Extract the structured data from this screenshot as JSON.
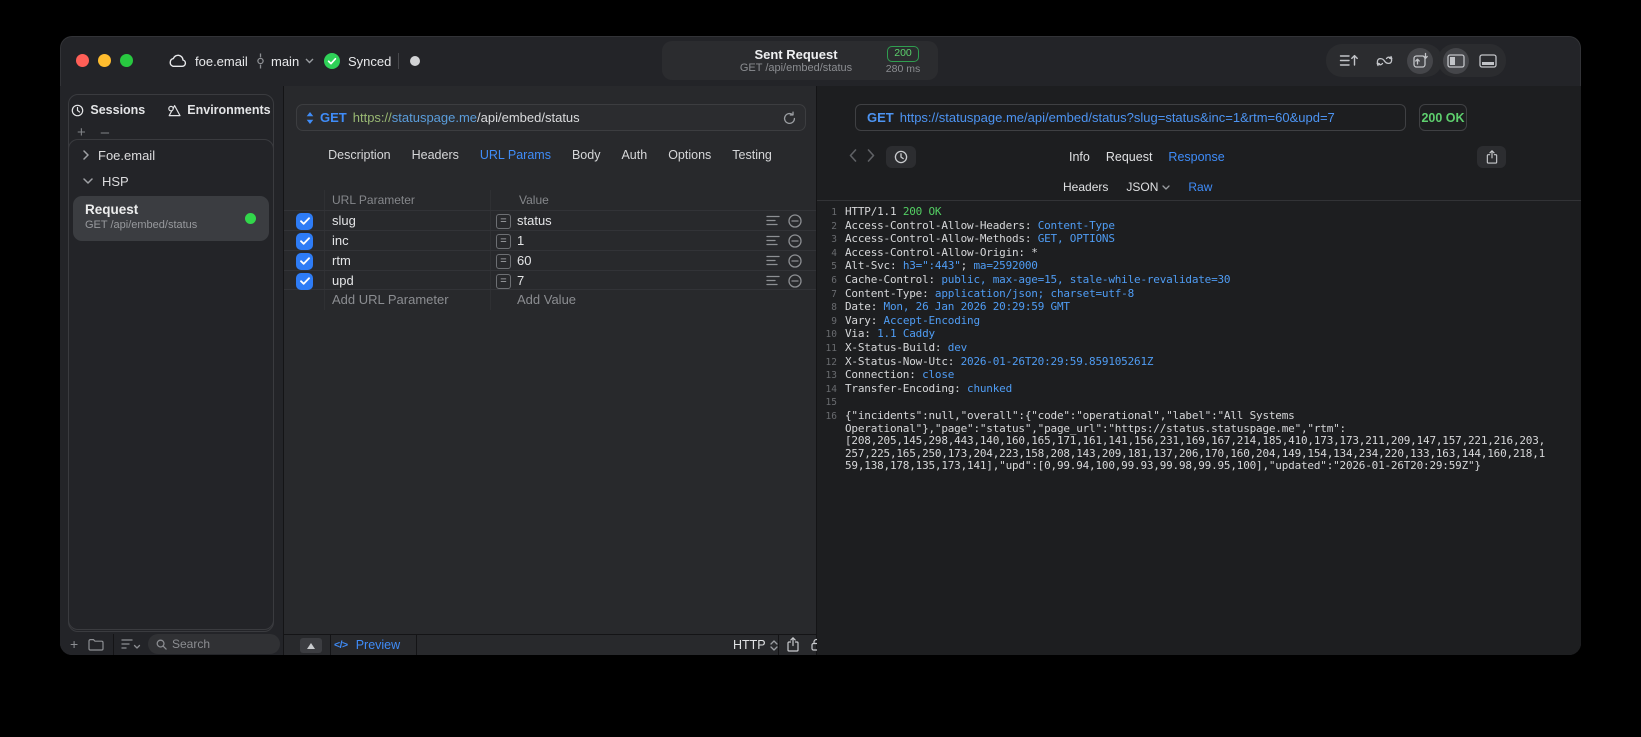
{
  "colors": {
    "accent_blue": "#3f8cf8",
    "status_green": "#30d158",
    "badge_green": "#5bd06c"
  },
  "titlebar": {
    "project": "foe.email",
    "branch": "main",
    "sync_status": "Synced",
    "request_summary": {
      "title": "Sent Request",
      "subtitle": "GET /api/embed/status",
      "status_code": "200",
      "duration": "280 ms"
    }
  },
  "sidebar": {
    "tabs": [
      {
        "label": "Sessions"
      },
      {
        "label": "Environments"
      }
    ],
    "tree": [
      {
        "label": "Foe.email"
      },
      {
        "label": "HSP"
      }
    ],
    "request_item": {
      "title": "Request",
      "subtitle": "GET /api/embed/status"
    },
    "search_placeholder": "Search"
  },
  "request_panel": {
    "method": "GET",
    "url_scheme": "https://",
    "url_host": "statuspage.me",
    "url_path": "/api/embed/status",
    "tabs": [
      "Description",
      "Headers",
      "URL Params",
      "Body",
      "Auth",
      "Options",
      "Testing"
    ],
    "active_tab": "URL Params",
    "table": {
      "columns": [
        "URL Parameter",
        "Value"
      ],
      "rows": [
        {
          "name": "slug",
          "value": "status",
          "enabled": true
        },
        {
          "name": "inc",
          "value": "1",
          "enabled": true
        },
        {
          "name": "rtm",
          "value": "60",
          "enabled": true
        },
        {
          "name": "upd",
          "value": "7",
          "enabled": true
        }
      ],
      "add_name": "Add URL Parameter",
      "add_value": "Add Value"
    },
    "footer": {
      "code_glyph": "</>",
      "preview": "Preview",
      "protocol": "HTTP"
    }
  },
  "response_panel": {
    "request_line": {
      "method": "GET",
      "url": "https://statuspage.me/api/embed/status?slug=status&inc=1&rtm=60&upd=7"
    },
    "status": "200 OK",
    "tabs": [
      "Info",
      "Request",
      "Response"
    ],
    "active_tab": "Response",
    "subtabs": [
      "Headers",
      "JSON",
      "Raw"
    ],
    "active_subtab": "Raw",
    "body_lines": [
      {
        "n": 1,
        "segs": [
          [
            "HTTP/1.1 ",
            "p"
          ],
          [
            "200 OK",
            "g"
          ]
        ]
      },
      {
        "n": 2,
        "segs": [
          [
            "Access-Control-Allow-Headers: ",
            "p"
          ],
          [
            "Content-Type",
            "b"
          ]
        ]
      },
      {
        "n": 3,
        "segs": [
          [
            "Access-Control-Allow-Methods: ",
            "p"
          ],
          [
            "GET, OPTIONS",
            "b"
          ]
        ]
      },
      {
        "n": 4,
        "segs": [
          [
            "Access-Control-Allow-Origin: ",
            "p"
          ],
          [
            "*",
            "p"
          ]
        ]
      },
      {
        "n": 5,
        "segs": [
          [
            "Alt-Svc: ",
            "p"
          ],
          [
            "h3=\":443\"",
            "b"
          ],
          [
            "; ",
            "p"
          ],
          [
            "ma=2592000",
            "b"
          ]
        ]
      },
      {
        "n": 6,
        "segs": [
          [
            "Cache-Control: ",
            "p"
          ],
          [
            "public, max-age=15, stale-while-revalidate=30",
            "b"
          ]
        ]
      },
      {
        "n": 7,
        "segs": [
          [
            "Content-Type: ",
            "p"
          ],
          [
            "application/json; charset=utf-8",
            "b"
          ]
        ]
      },
      {
        "n": 8,
        "segs": [
          [
            "Date: ",
            "p"
          ],
          [
            "Mon, 26 Jan 2026 20:29:59 GMT",
            "b"
          ]
        ]
      },
      {
        "n": 9,
        "segs": [
          [
            "Vary: ",
            "p"
          ],
          [
            "Accept-Encoding",
            "b"
          ]
        ]
      },
      {
        "n": 10,
        "segs": [
          [
            "Via: ",
            "p"
          ],
          [
            "1.1 Caddy",
            "b"
          ]
        ]
      },
      {
        "n": 11,
        "segs": [
          [
            "X-Status-Build: ",
            "p"
          ],
          [
            "dev",
            "b"
          ]
        ]
      },
      {
        "n": 12,
        "segs": [
          [
            "X-Status-Now-Utc: ",
            "p"
          ],
          [
            "2026-01-26T20:29:59.859105261Z",
            "b"
          ]
        ]
      },
      {
        "n": 13,
        "segs": [
          [
            "Connection: ",
            "p"
          ],
          [
            "close",
            "b"
          ]
        ]
      },
      {
        "n": 14,
        "segs": [
          [
            "Transfer-Encoding: ",
            "p"
          ],
          [
            "chunked",
            "b"
          ]
        ]
      },
      {
        "n": 15,
        "segs": []
      },
      {
        "n": 16,
        "segs": [
          [
            "{\"incidents\":null,\"overall\":{\"code\":\"operational\",\"label\":\"All Systems Operational\"},\"page\":\"status\",\"page_url\":\"https://status.statuspage.me\",\"rtm\":[208,205,145,298,443,140,160,165,171,161,141,156,231,169,167,214,185,410,173,173,211,209,147,157,221,216,203,257,225,165,250,173,204,223,158,208,143,209,181,137,206,170,160,204,149,154,134,234,220,133,163,144,160,218,159,138,178,135,173,141],\"upd\":[0,99.94,100,99.93,99.98,99.95,100],\"updated\":\"2026-01-26T20:29:59Z\"}",
            "p"
          ]
        ]
      }
    ]
  }
}
